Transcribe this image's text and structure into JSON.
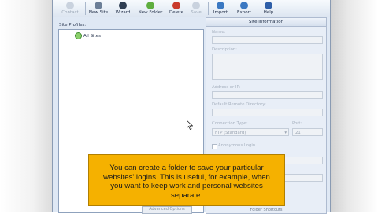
{
  "colors": {
    "window_bg": "#dfe8f4",
    "tooltip_bg": "#f5b100",
    "accent": "#3d8a2e"
  },
  "toolbar": {
    "items": [
      {
        "label": "Contact",
        "icon": "contact-icon",
        "disabled": true
      },
      {
        "label": "New Site",
        "icon": "new-site-icon",
        "disabled": false
      },
      {
        "label": "Wizard",
        "icon": "wizard-icon",
        "disabled": false
      },
      {
        "label": "New Folder",
        "icon": "new-folder-icon",
        "disabled": false
      },
      {
        "label": "Delete",
        "icon": "delete-icon",
        "disabled": false
      },
      {
        "label": "Save",
        "icon": "save-icon",
        "disabled": true
      },
      {
        "label": "Import",
        "icon": "import-icon",
        "disabled": false
      },
      {
        "label": "Export",
        "icon": "export-icon",
        "disabled": false
      },
      {
        "label": "Help",
        "icon": "help-icon",
        "disabled": false
      }
    ]
  },
  "site_profiles": {
    "label": "Site Profiles:",
    "root_item": "All Sites"
  },
  "site_info": {
    "title": "Site Information",
    "name_label": "Name:",
    "description_label": "Description:",
    "address_label": "Address or IP:",
    "remote_dir_label": "Default Remote Directory:",
    "connection_type_label": "Connection Type:",
    "connection_type_value": "FTP (Standard)",
    "port_label": "Port:",
    "port_value": "21",
    "anonymous_label": "Anonymous Login",
    "shortcuts_label": "Folder Shortcuts"
  },
  "footer": {
    "tab_label": "Advanced Options"
  },
  "tooltip": {
    "text": "You can create a folder to save your particular websites' logins. This is useful, for example, when you want to keep work and personal websites separate."
  }
}
